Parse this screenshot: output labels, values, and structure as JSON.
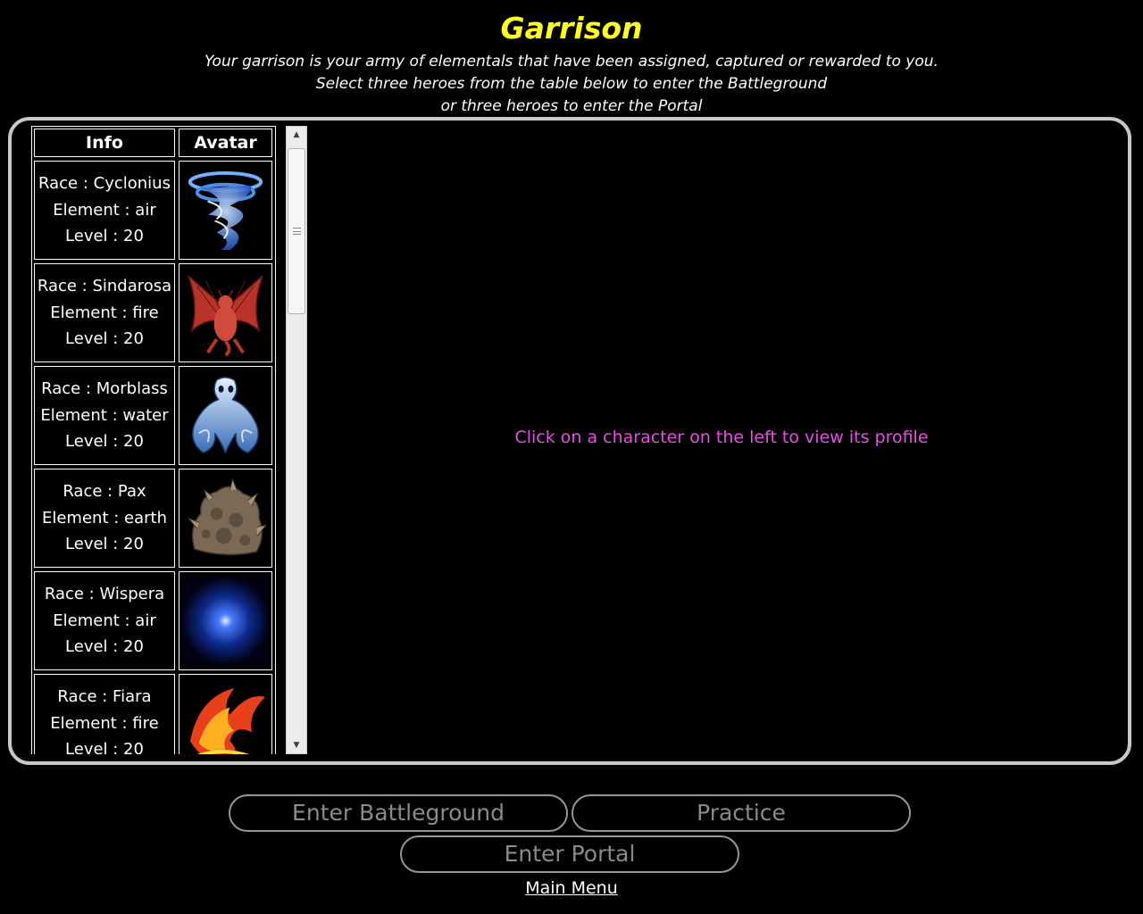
{
  "header": {
    "title": "Garrison",
    "subtitle_lines": [
      "Your garrison is your army of elementals that have been assigned, captured or rewarded to you.",
      "Select three heroes from the table below to enter the Battleground",
      "or three heroes to enter the Portal"
    ]
  },
  "table": {
    "headers": {
      "info": "Info",
      "avatar": "Avatar"
    },
    "rows": [
      {
        "race": "Race : Cyclonius",
        "element": "Element : air",
        "level": "Level : 20",
        "avatar_icon": "tornado-elemental-icon"
      },
      {
        "race": "Race : Sindarosa",
        "element": "Element : fire",
        "level": "Level : 20",
        "avatar_icon": "red-dragon-icon"
      },
      {
        "race": "Race : Morblass",
        "element": "Element : water",
        "level": "Level : 20",
        "avatar_icon": "water-spirit-icon"
      },
      {
        "race": "Race : Pax",
        "element": "Element : earth",
        "level": "Level : 20",
        "avatar_icon": "rock-golem-icon"
      },
      {
        "race": "Race : Wispera",
        "element": "Element : air",
        "level": "Level : 20",
        "avatar_icon": "blue-wisp-icon"
      },
      {
        "race": "Race : Fiara",
        "element": "Element : fire",
        "level": "Level : 20",
        "avatar_icon": "fire-phoenix-icon"
      }
    ]
  },
  "profile": {
    "hint": "Click on a character on the left to view its profile"
  },
  "buttons": {
    "battleground": "Enter Battleground",
    "practice": "Practice",
    "portal": "Enter Portal"
  },
  "links": {
    "main_menu": "Main Menu"
  },
  "colors": {
    "title": "#ffff1e",
    "hint": "#e64ee6",
    "panel_border": "#c8c8c8",
    "button_text": "#8a8a8a"
  }
}
